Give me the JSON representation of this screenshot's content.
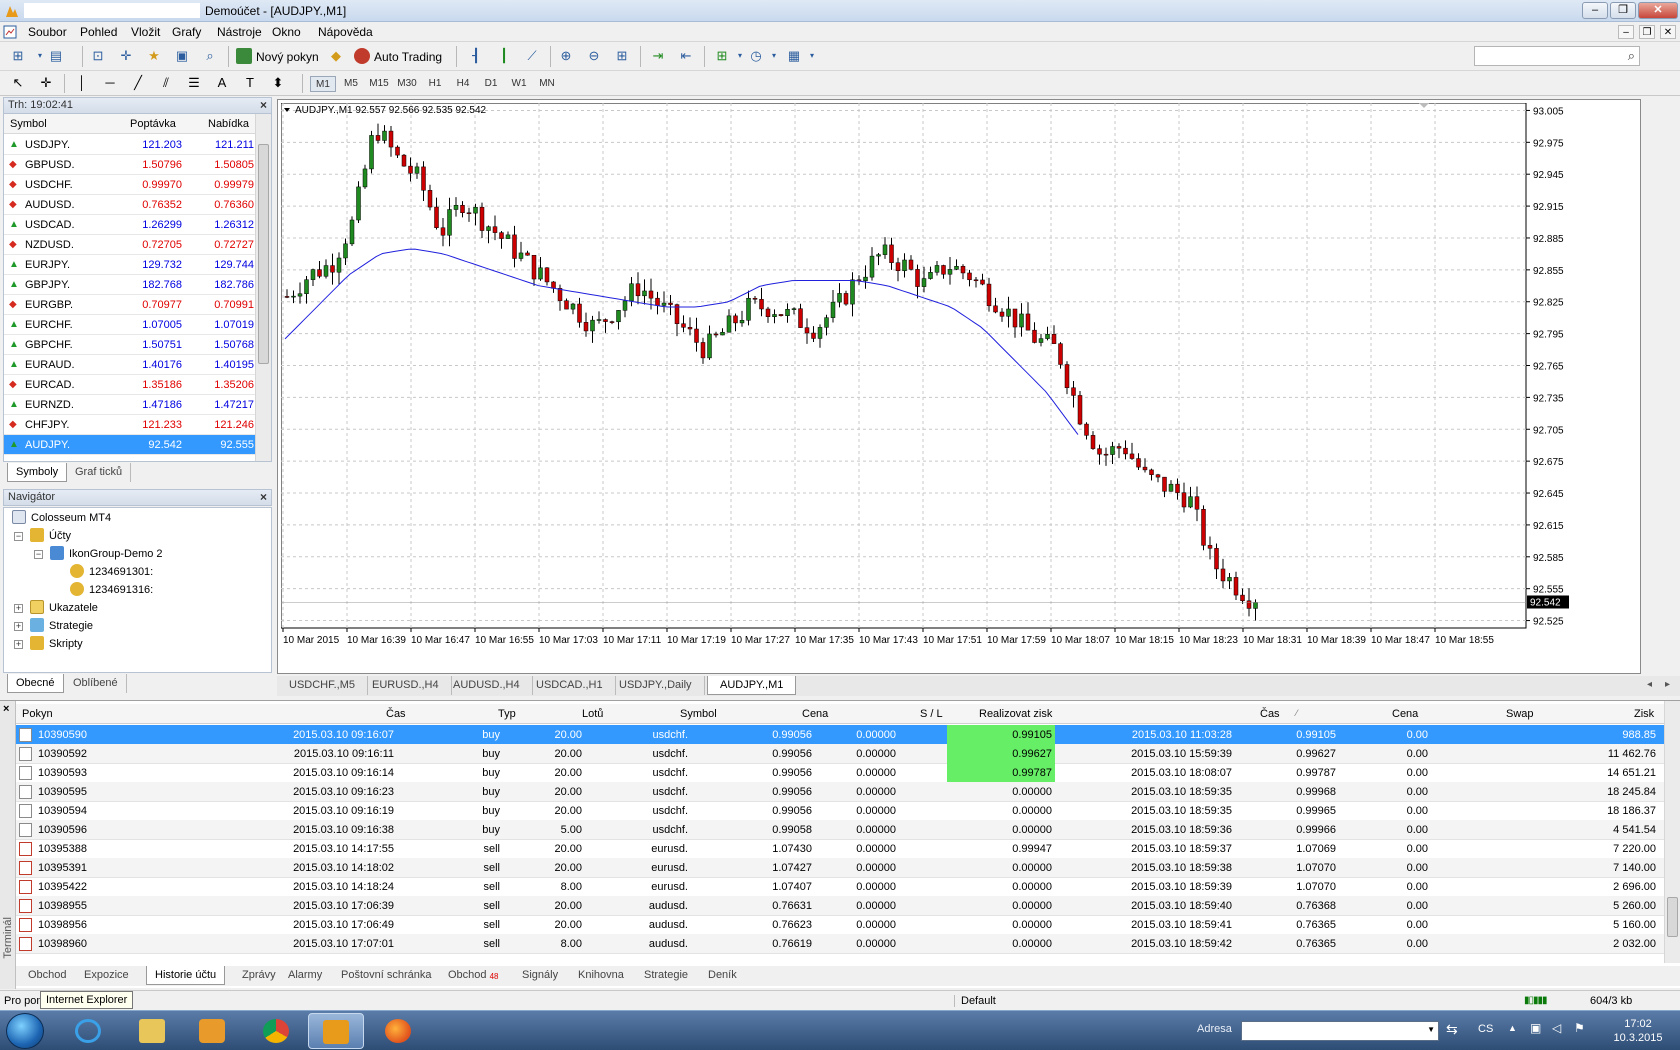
{
  "window": {
    "title": "Demoúčet - [AUDJPY.,M1]",
    "buttons": [
      "–",
      "❐",
      "✕"
    ]
  },
  "menu": [
    "Soubor",
    "Pohled",
    "Vložit",
    "Grafy",
    "Nástroje",
    "Okno",
    "Nápověda"
  ],
  "toolbar": {
    "new_order": "Nový pokyn",
    "auto_trading": "Auto Trading",
    "timeframes": [
      "M1",
      "M5",
      "M15",
      "M30",
      "H1",
      "H4",
      "D1",
      "W1",
      "MN"
    ],
    "active_timeframe": "M1",
    "search_placeholder": ""
  },
  "market_watch": {
    "header": "Trh: 19:02:41",
    "columns": [
      "Symbol",
      "Poptávka",
      "Nabídka"
    ],
    "rows": [
      {
        "symbol": "USDJPY.",
        "bid": "121.203",
        "ask": "121.211",
        "dir": "up"
      },
      {
        "symbol": "GBPUSD.",
        "bid": "1.50796",
        "ask": "1.50805",
        "dir": "down"
      },
      {
        "symbol": "USDCHF.",
        "bid": "0.99970",
        "ask": "0.99979",
        "dir": "down"
      },
      {
        "symbol": "AUDUSD.",
        "bid": "0.76352",
        "ask": "0.76360",
        "dir": "down"
      },
      {
        "symbol": "USDCAD.",
        "bid": "1.26299",
        "ask": "1.26312",
        "dir": "up"
      },
      {
        "symbol": "NZDUSD.",
        "bid": "0.72705",
        "ask": "0.72727",
        "dir": "down"
      },
      {
        "symbol": "EURJPY.",
        "bid": "129.732",
        "ask": "129.744",
        "dir": "up"
      },
      {
        "symbol": "GBPJPY.",
        "bid": "182.768",
        "ask": "182.786",
        "dir": "up"
      },
      {
        "symbol": "EURGBP.",
        "bid": "0.70977",
        "ask": "0.70991",
        "dir": "down"
      },
      {
        "symbol": "EURCHF.",
        "bid": "1.07005",
        "ask": "1.07019",
        "dir": "up"
      },
      {
        "symbol": "GBPCHF.",
        "bid": "1.50751",
        "ask": "1.50768",
        "dir": "up"
      },
      {
        "symbol": "EURAUD.",
        "bid": "1.40176",
        "ask": "1.40195",
        "dir": "up"
      },
      {
        "symbol": "EURCAD.",
        "bid": "1.35186",
        "ask": "1.35206",
        "dir": "down"
      },
      {
        "symbol": "EURNZD.",
        "bid": "1.47186",
        "ask": "1.47217",
        "dir": "up"
      },
      {
        "symbol": "CHFJPY.",
        "bid": "121.233",
        "ask": "121.246",
        "dir": "down"
      },
      {
        "symbol": "AUDJPY.",
        "bid": "92.542",
        "ask": "92.555",
        "dir": "up",
        "selected": true
      }
    ],
    "tabs": [
      "Symboly",
      "Graf ticků"
    ]
  },
  "navigator": {
    "header": "Navigátor",
    "items": [
      {
        "label": "Colosseum MT4"
      },
      {
        "label": "Účty"
      },
      {
        "label": "IkonGroup-Demo 2"
      },
      {
        "label": "1234691301:"
      },
      {
        "label": "1234691316:"
      },
      {
        "label": "Ukazatele"
      },
      {
        "label": "Strategie"
      },
      {
        "label": "Skripty"
      }
    ],
    "tabs": [
      "Obecné",
      "Oblíbené"
    ]
  },
  "chart_data": {
    "type": "candlestick",
    "title": "AUDJPY.,M1  92.557 92.566 92.535 92.542",
    "y_ticks": [
      "93.005",
      "92.975",
      "92.945",
      "92.915",
      "92.885",
      "92.855",
      "92.825",
      "92.795",
      "92.765",
      "92.735",
      "92.705",
      "92.675",
      "92.645",
      "92.615",
      "92.585",
      "92.555",
      "92.525"
    ],
    "ylim": [
      92.518,
      93.012
    ],
    "x_ticks": [
      "10 Mar 2015",
      "10 Mar 16:39",
      "10 Mar 16:47",
      "10 Mar 16:55",
      "10 Mar 17:03",
      "10 Mar 17:11",
      "10 Mar 17:19",
      "10 Mar 17:27",
      "10 Mar 17:35",
      "10 Mar 17:43",
      "10 Mar 17:51",
      "10 Mar 17:59",
      "10 Mar 18:07",
      "10 Mar 18:15",
      "10 Mar 18:23",
      "10 Mar 18:31",
      "10 Mar 18:39",
      "10 Mar 18:47",
      "10 Mar 18:55"
    ],
    "current_price": "92.542",
    "up_color": "#1f8a1f",
    "down_color": "#cc0000",
    "ma_color": "#2020dd",
    "anchors": [
      92.83,
      92.85,
      92.86,
      92.9,
      92.99,
      92.96,
      92.94,
      92.89,
      92.92,
      92.9,
      92.88,
      92.86,
      92.84,
      92.82,
      92.8,
      92.82,
      92.84,
      92.82,
      92.8,
      92.78,
      92.8,
      92.82,
      92.82,
      92.81,
      92.8,
      92.82,
      92.85,
      92.87,
      92.86,
      92.84,
      92.86,
      92.85,
      92.83,
      92.81,
      92.79,
      92.78,
      92.72,
      92.68,
      92.69,
      92.66,
      92.65,
      92.64,
      92.58,
      92.56,
      92.542
    ],
    "ma": [
      92.79,
      92.82,
      92.85,
      92.87,
      92.875,
      92.87,
      92.86,
      92.85,
      92.84,
      92.835,
      92.83,
      92.825,
      92.82,
      92.82,
      92.825,
      92.84,
      92.845,
      92.845,
      92.845,
      92.84,
      92.83,
      92.82,
      92.8,
      92.77,
      92.74,
      92.7
    ]
  },
  "chart_tabs": [
    "USDCHF.,M5",
    "EURUSD.,H4",
    "AUDUSD.,H4",
    "USDCAD.,H1",
    "USDJPY.,Daily",
    "AUDJPY.,M1"
  ],
  "terminal": {
    "side_label": "Terminál",
    "columns": [
      "Pokyn",
      "Čas",
      "Typ",
      "Lotů",
      "Symbol",
      "Cena",
      "S / L",
      "Realizovat zisk",
      "Čas",
      "Cena",
      "Swap",
      "Zisk"
    ],
    "rows": [
      {
        "order": "10390590",
        "open_time": "2015.03.10 09:16:07",
        "type": "buy",
        "lots": "20.00",
        "symbol": "usdchf.",
        "price": "0.99056",
        "sl": "0.00000",
        "tp": "0.99105",
        "close_time": "2015.03.10 11:03:28",
        "close_price": "0.99105",
        "swap": "0.00",
        "profit": "988.85",
        "tp_hit": true,
        "selected": true
      },
      {
        "order": "10390592",
        "open_time": "2015.03.10 09:16:11",
        "type": "buy",
        "lots": "20.00",
        "symbol": "usdchf.",
        "price": "0.99056",
        "sl": "0.00000",
        "tp": "0.99627",
        "close_time": "2015.03.10 15:59:39",
        "close_price": "0.99627",
        "swap": "0.00",
        "profit": "11 462.76",
        "tp_hit": true
      },
      {
        "order": "10390593",
        "open_time": "2015.03.10 09:16:14",
        "type": "buy",
        "lots": "20.00",
        "symbol": "usdchf.",
        "price": "0.99056",
        "sl": "0.00000",
        "tp": "0.99787",
        "close_time": "2015.03.10 18:08:07",
        "close_price": "0.99787",
        "swap": "0.00",
        "profit": "14 651.21",
        "tp_hit": true
      },
      {
        "order": "10390595",
        "open_time": "2015.03.10 09:16:23",
        "type": "buy",
        "lots": "20.00",
        "symbol": "usdchf.",
        "price": "0.99056",
        "sl": "0.00000",
        "tp": "0.00000",
        "close_time": "2015.03.10 18:59:35",
        "close_price": "0.99968",
        "swap": "0.00",
        "profit": "18 245.84"
      },
      {
        "order": "10390594",
        "open_time": "2015.03.10 09:16:19",
        "type": "buy",
        "lots": "20.00",
        "symbol": "usdchf.",
        "price": "0.99056",
        "sl": "0.00000",
        "tp": "0.00000",
        "close_time": "2015.03.10 18:59:35",
        "close_price": "0.99965",
        "swap": "0.00",
        "profit": "18 186.37"
      },
      {
        "order": "10390596",
        "open_time": "2015.03.10 09:16:38",
        "type": "buy",
        "lots": "5.00",
        "symbol": "usdchf.",
        "price": "0.99058",
        "sl": "0.00000",
        "tp": "0.00000",
        "close_time": "2015.03.10 18:59:36",
        "close_price": "0.99966",
        "swap": "0.00",
        "profit": "4 541.54"
      },
      {
        "order": "10395388",
        "open_time": "2015.03.10 14:17:55",
        "type": "sell",
        "lots": "20.00",
        "symbol": "eurusd.",
        "price": "1.07430",
        "sl": "0.00000",
        "tp": "0.99947",
        "close_time": "2015.03.10 18:59:37",
        "close_price": "1.07069",
        "swap": "0.00",
        "profit": "7 220.00"
      },
      {
        "order": "10395391",
        "open_time": "2015.03.10 14:18:02",
        "type": "sell",
        "lots": "20.00",
        "symbol": "eurusd.",
        "price": "1.07427",
        "sl": "0.00000",
        "tp": "0.00000",
        "close_time": "2015.03.10 18:59:38",
        "close_price": "1.07070",
        "swap": "0.00",
        "profit": "7 140.00"
      },
      {
        "order": "10395422",
        "open_time": "2015.03.10 14:18:24",
        "type": "sell",
        "lots": "8.00",
        "symbol": "eurusd.",
        "price": "1.07407",
        "sl": "0.00000",
        "tp": "0.00000",
        "close_time": "2015.03.10 18:59:39",
        "close_price": "1.07070",
        "swap": "0.00",
        "profit": "2 696.00"
      },
      {
        "order": "10398955",
        "open_time": "2015.03.10 17:06:39",
        "type": "sell",
        "lots": "20.00",
        "symbol": "audusd.",
        "price": "0.76631",
        "sl": "0.00000",
        "tp": "0.00000",
        "close_time": "2015.03.10 18:59:40",
        "close_price": "0.76368",
        "swap": "0.00",
        "profit": "5 260.00"
      },
      {
        "order": "10398956",
        "open_time": "2015.03.10 17:06:49",
        "type": "sell",
        "lots": "20.00",
        "symbol": "audusd.",
        "price": "0.76623",
        "sl": "0.00000",
        "tp": "0.00000",
        "close_time": "2015.03.10 18:59:41",
        "close_price": "0.76365",
        "swap": "0.00",
        "profit": "5 160.00"
      },
      {
        "order": "10398960",
        "open_time": "2015.03.10 17:07:01",
        "type": "sell",
        "lots": "8.00",
        "symbol": "audusd.",
        "price": "0.76619",
        "sl": "0.00000",
        "tp": "0.00000",
        "close_time": "2015.03.10 18:59:42",
        "close_price": "0.76365",
        "swap": "0.00",
        "profit": "2 032.00"
      }
    ],
    "tabs": [
      "Obchod",
      "Expozice",
      "Historie účtu",
      "Zprávy",
      "Alarmy",
      "Poštovní schránka",
      "Obchod",
      "Signály",
      "Knihovna",
      "Strategie",
      "Deník"
    ],
    "active_tab": 2,
    "obchod_badge": "48"
  },
  "status": {
    "left": "Pro pomoc",
    "tooltip": "Internet Explorer",
    "profile": "Default",
    "traffic": "604/3 kb"
  },
  "taskbar": {
    "address_label": "Adresa",
    "lang": "CS",
    "time": "17:02",
    "date": "10.3.2015"
  }
}
